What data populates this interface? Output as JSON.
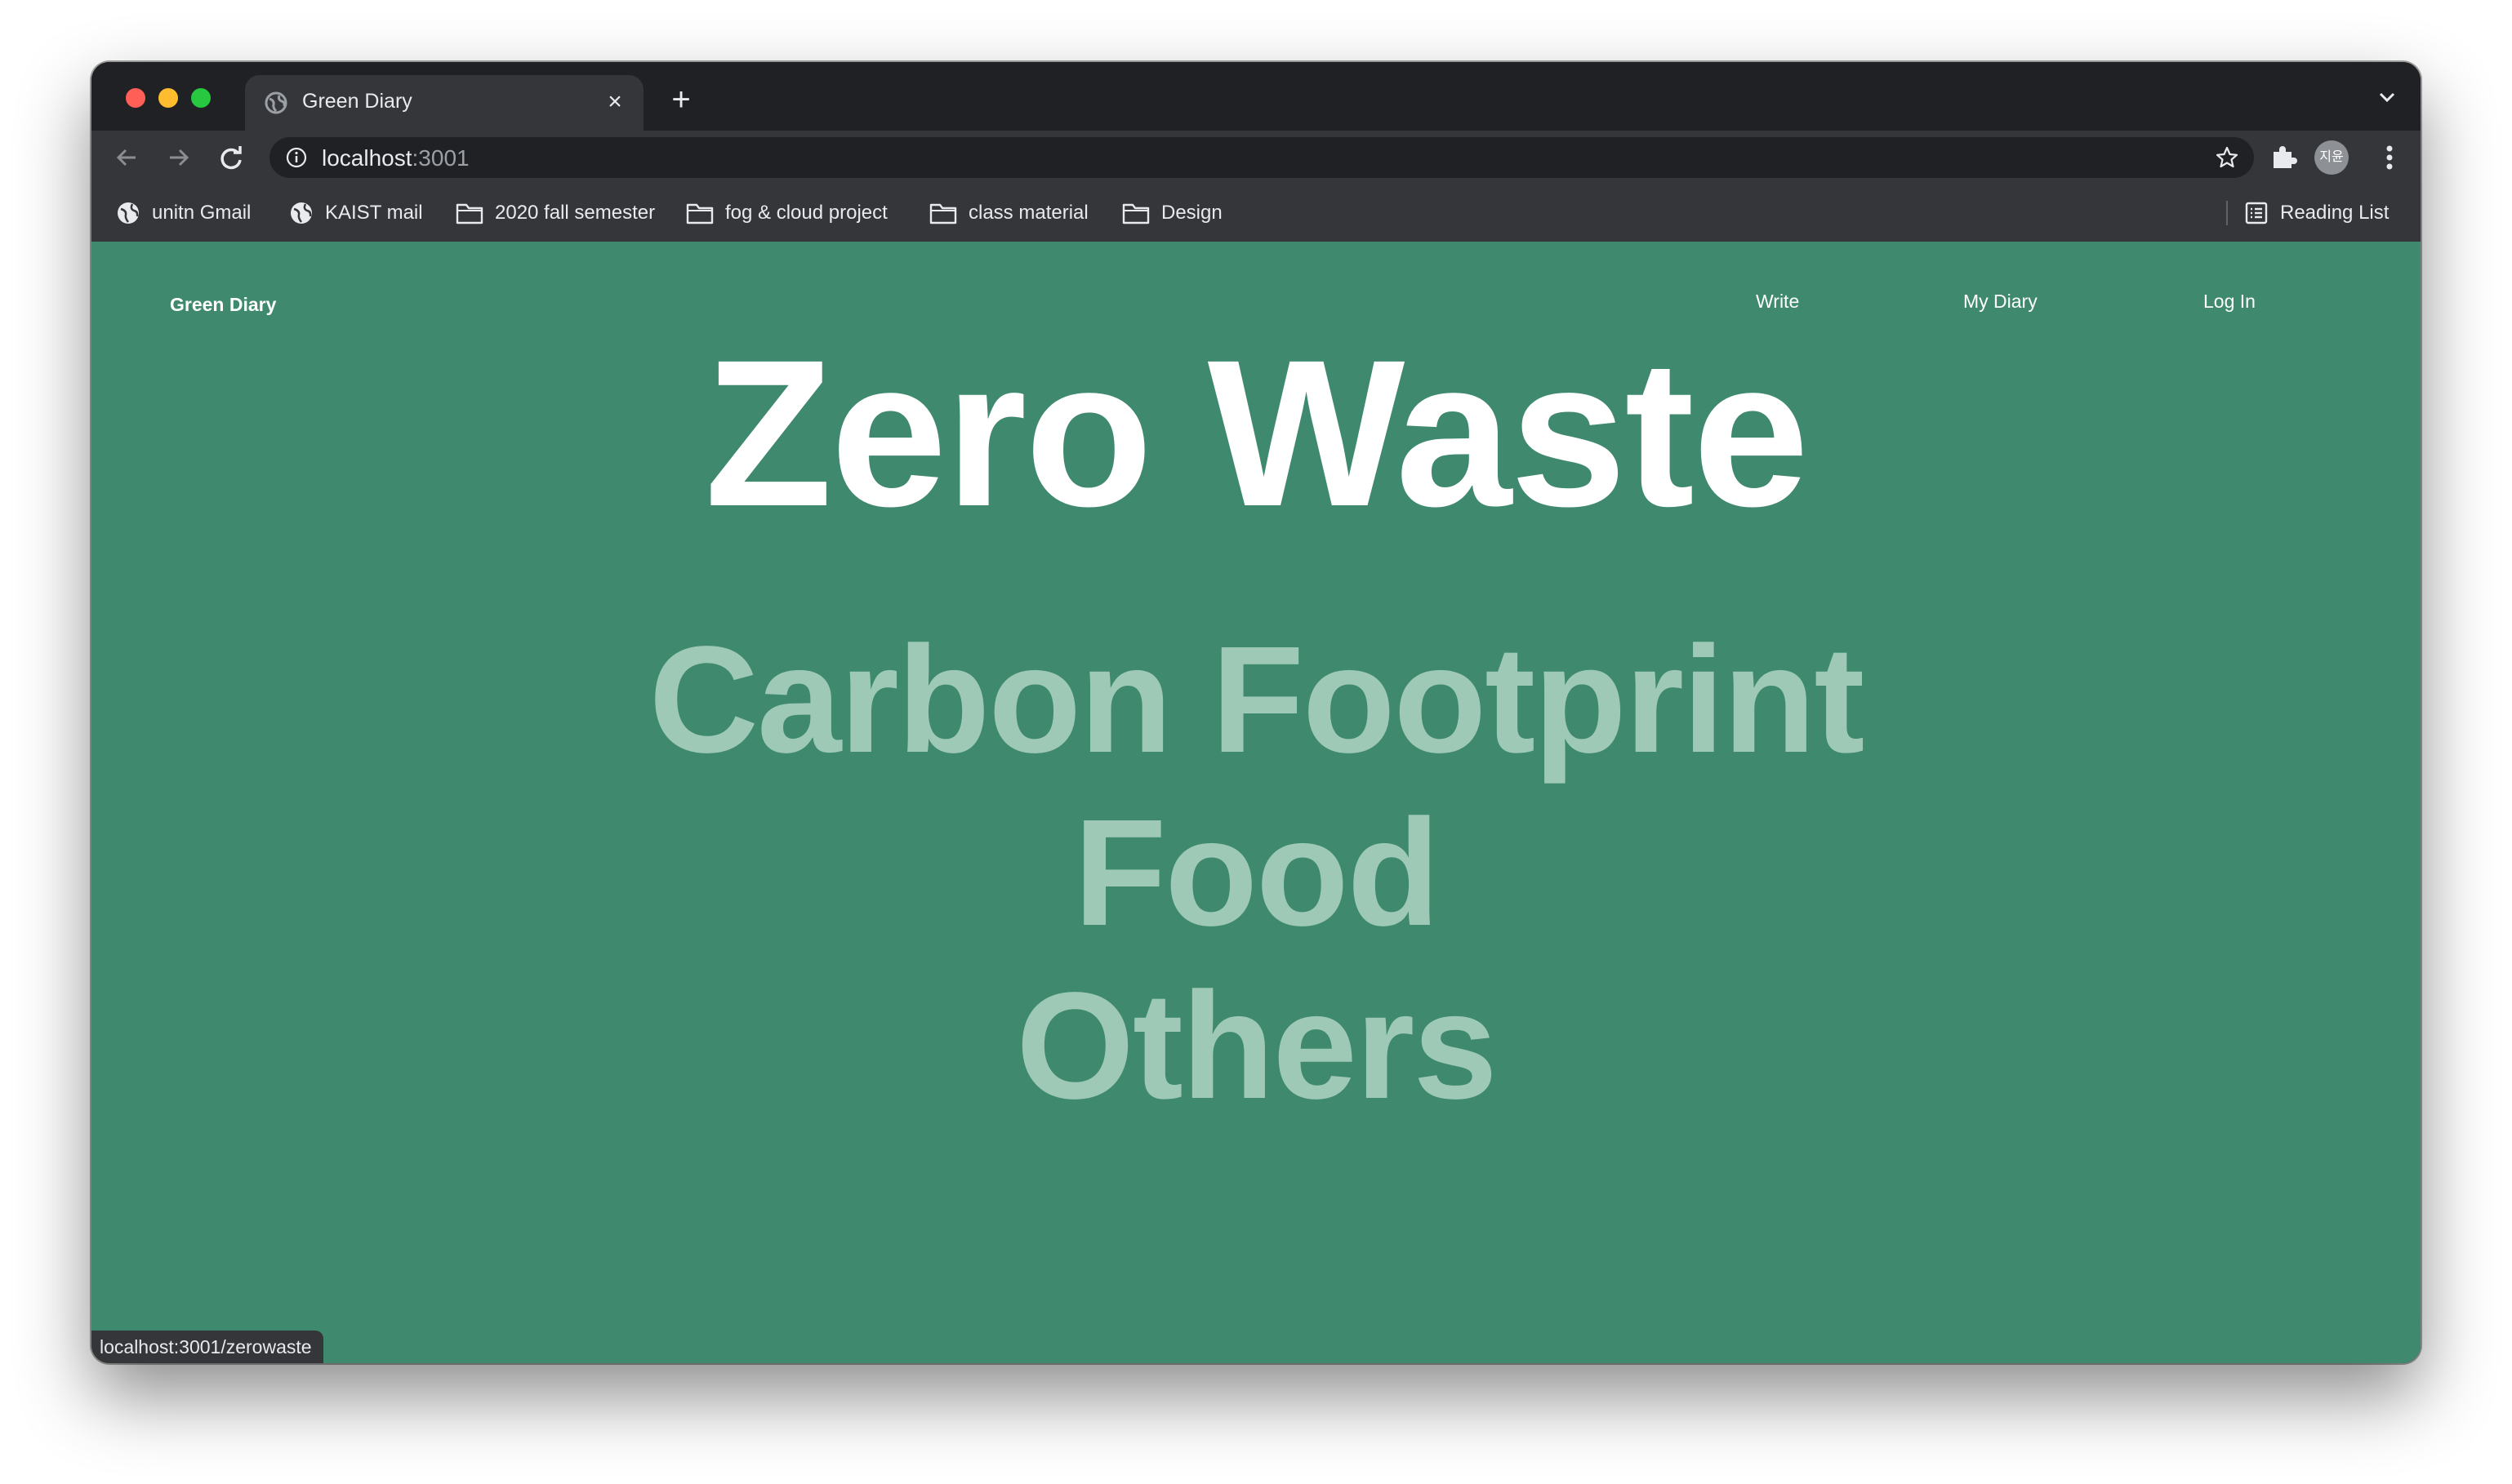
{
  "browser": {
    "tab": {
      "title": "Green Diary",
      "close": "×"
    },
    "new_tab": "+",
    "address": {
      "host": "localhost",
      "port": ":3001"
    },
    "profile_initials": "지윤",
    "bookmarks": [
      "unitn Gmail",
      "KAIST mail",
      "2020 fall semester",
      "fog & cloud project",
      "class material",
      "Design"
    ],
    "reading_list": "Reading List",
    "status_url": "localhost:3001/zerowaste"
  },
  "site": {
    "brand": "Green Diary",
    "nav": {
      "write": "Write",
      "my_diary": "My Diary",
      "login": "Log In"
    },
    "categories": [
      "Zero Waste",
      "Carbon Footprint",
      "Food",
      "Others"
    ]
  },
  "colors": {
    "page_bg": "#3f8a6e",
    "active_category": "#ffffff",
    "inactive_category": "#9ec9b6",
    "browser_dark": "#202124",
    "browser_toolbar": "#35363a"
  }
}
